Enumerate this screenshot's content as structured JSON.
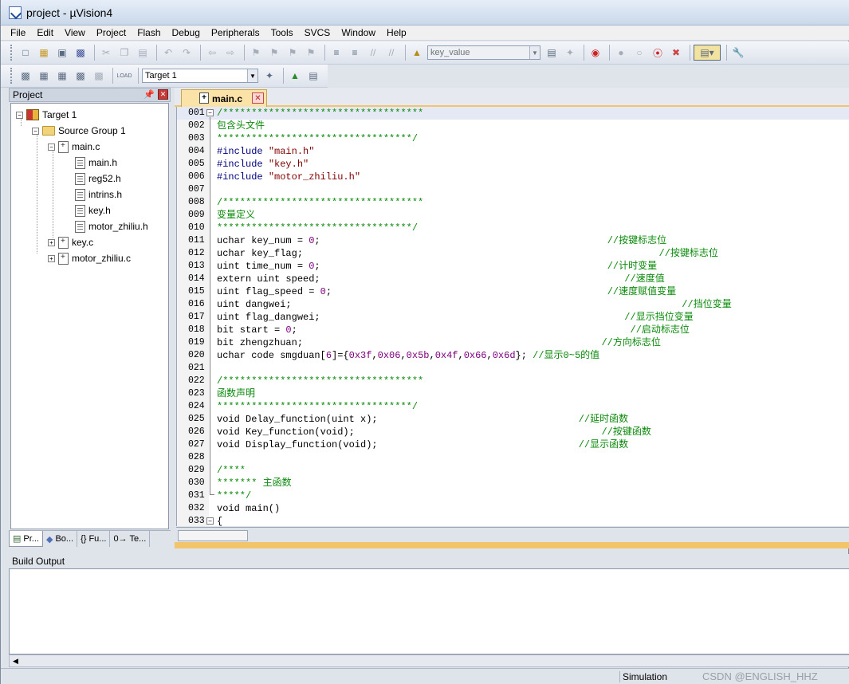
{
  "window": {
    "title": "project  - µVision4"
  },
  "menu": [
    "File",
    "Edit",
    "View",
    "Project",
    "Flash",
    "Debug",
    "Peripherals",
    "Tools",
    "SVCS",
    "Window",
    "Help"
  ],
  "toolbar": {
    "find_combo_value": "key_value",
    "target_combo_value": "Target 1",
    "load_label": "LOAD"
  },
  "project_panel": {
    "title": "Project",
    "tree": {
      "target": "Target 1",
      "group": "Source Group 1",
      "main_c": "main.c",
      "main_children": [
        "main.h",
        "reg52.h",
        "intrins.h",
        "key.h",
        "motor_zhiliu.h"
      ],
      "key_c": "key.c",
      "motor_c": "motor_zhiliu.c"
    },
    "tabs": [
      "Pr...",
      "Bo...",
      "{} Fu...",
      "0→ Te..."
    ]
  },
  "editor": {
    "tab_label": "main.c",
    "lines": [
      {
        "n": "001",
        "segs": [
          [
            "cm",
            "/***********************************"
          ]
        ]
      },
      {
        "n": "002",
        "segs": [
          [
            "cm",
            "包含头文件"
          ]
        ]
      },
      {
        "n": "003",
        "segs": [
          [
            "cm",
            "**********************************/"
          ]
        ]
      },
      {
        "n": "004",
        "segs": [
          [
            "kw",
            "#include "
          ],
          [
            "str",
            "\"main.h\""
          ]
        ]
      },
      {
        "n": "005",
        "segs": [
          [
            "kw",
            "#include "
          ],
          [
            "str",
            "\"key.h\""
          ]
        ]
      },
      {
        "n": "006",
        "segs": [
          [
            "kw",
            "#include "
          ],
          [
            "str",
            "\"motor_zhiliu.h\""
          ]
        ]
      },
      {
        "n": "007",
        "segs": []
      },
      {
        "n": "008",
        "segs": [
          [
            "cm",
            "/***********************************"
          ]
        ]
      },
      {
        "n": "009",
        "segs": [
          [
            "cm",
            "变量定义"
          ]
        ]
      },
      {
        "n": "010",
        "segs": [
          [
            "cm",
            "**********************************/"
          ]
        ]
      },
      {
        "n": "011",
        "segs": [
          [
            "",
            "uchar key_num = "
          ],
          [
            "num",
            "0"
          ],
          [
            "",
            ";                                                  "
          ],
          [
            "cm",
            "//按键标志位"
          ]
        ]
      },
      {
        "n": "012",
        "segs": [
          [
            "",
            "uchar key_flag;                                                          "
          ],
          [
            "cm",
            "    //按键标志位"
          ]
        ]
      },
      {
        "n": "013",
        "segs": [
          [
            "",
            "uint time_num = "
          ],
          [
            "num",
            "0"
          ],
          [
            "",
            ";                                                  "
          ],
          [
            "cm",
            "//计时变量"
          ]
        ]
      },
      {
        "n": "014",
        "segs": [
          [
            "",
            "extern uint speed;                                                     "
          ],
          [
            "cm",
            "//速度值"
          ]
        ]
      },
      {
        "n": "015",
        "segs": [
          [
            "",
            "uint flag_speed = "
          ],
          [
            "num",
            "0"
          ],
          [
            "",
            ";                                                "
          ],
          [
            "cm",
            "//速度赋值变量"
          ]
        ]
      },
      {
        "n": "016",
        "segs": [
          [
            "",
            "uint dangwei;                                                                "
          ],
          [
            "cm",
            "    //挡位变量"
          ]
        ]
      },
      {
        "n": "017",
        "segs": [
          [
            "",
            "uint flag_dangwei;                                                     "
          ],
          [
            "cm",
            "//显示挡位变量"
          ]
        ]
      },
      {
        "n": "018",
        "segs": [
          [
            "",
            "bit start = "
          ],
          [
            "num",
            "0"
          ],
          [
            "",
            ";                                                        "
          ],
          [
            "cm",
            "  //启动标志位"
          ]
        ]
      },
      {
        "n": "019",
        "segs": [
          [
            "",
            "bit zhengzhuan;                                                    "
          ],
          [
            "cm",
            "//方向标志位"
          ]
        ]
      },
      {
        "n": "020",
        "segs": [
          [
            "",
            "uchar code smgduan["
          ],
          [
            "num",
            "6"
          ],
          [
            "",
            "]={"
          ],
          [
            "num",
            "0x3f"
          ],
          [
            "",
            ","
          ],
          [
            "num",
            "0x06"
          ],
          [
            "",
            ","
          ],
          [
            "num",
            "0x5b"
          ],
          [
            "",
            ","
          ],
          [
            "num",
            "0x4f"
          ],
          [
            "",
            ","
          ],
          [
            "num",
            "0x66"
          ],
          [
            "",
            ","
          ],
          [
            "num",
            "0x6d"
          ],
          [
            "",
            "}; "
          ],
          [
            "cm",
            "//显示0~5的值"
          ]
        ]
      },
      {
        "n": "021",
        "segs": []
      },
      {
        "n": "022",
        "segs": [
          [
            "cm",
            "/***********************************"
          ]
        ]
      },
      {
        "n": "023",
        "segs": [
          [
            "cm",
            "函数声明"
          ]
        ]
      },
      {
        "n": "024",
        "segs": [
          [
            "cm",
            "**********************************/"
          ]
        ]
      },
      {
        "n": "025",
        "segs": [
          [
            "",
            "void Delay_function(uint x);                                   "
          ],
          [
            "cm",
            "//延时函数"
          ]
        ]
      },
      {
        "n": "026",
        "segs": [
          [
            "",
            "void Key_function(void);                                           "
          ],
          [
            "cm",
            "//按键函数"
          ]
        ]
      },
      {
        "n": "027",
        "segs": [
          [
            "",
            "void Display_function(void);                                   "
          ],
          [
            "cm",
            "//显示函数"
          ]
        ]
      },
      {
        "n": "028",
        "segs": []
      },
      {
        "n": "029",
        "segs": [
          [
            "cm",
            "/****"
          ]
        ]
      },
      {
        "n": "030",
        "segs": [
          [
            "cm",
            "******* 主函数"
          ]
        ]
      },
      {
        "n": "031",
        "segs": [
          [
            "cm",
            "*****/"
          ]
        ]
      },
      {
        "n": "032",
        "segs": [
          [
            "",
            "void main()"
          ]
        ]
      },
      {
        "n": "033",
        "segs": [
          [
            "",
            "{"
          ]
        ]
      }
    ]
  },
  "build_output": {
    "title": "Build Output"
  },
  "status": {
    "mode": "Simulation",
    "watermark": "CSDN @ENGLISH_HHZ"
  }
}
